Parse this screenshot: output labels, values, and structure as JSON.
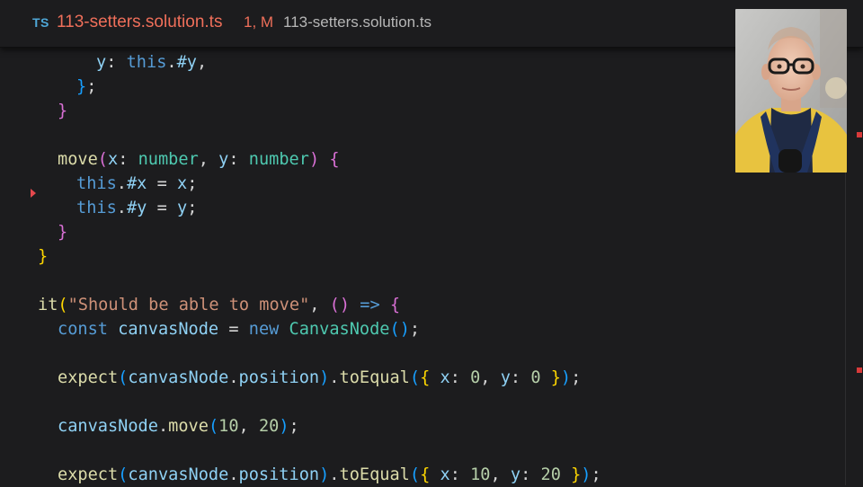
{
  "tab": {
    "lang_badge": "TS",
    "file_name": "113-setters.solution.ts",
    "status": "1, M",
    "breadcrumb": "113-setters.solution.ts"
  },
  "icons": {
    "fold": "fold-chevron-icon",
    "scroll_markers": "error-marker-icon"
  },
  "colors": {
    "background": "#1c1c1e",
    "modified_tab": "#ef6f5a",
    "ts_badge": "#4fa8d8",
    "error_marker": "#d83a3a"
  },
  "code": {
    "l1": {
      "a": "y",
      "b": ":",
      "c": "this",
      "d": ".",
      "e": "#y",
      "f": ","
    },
    "l2": {
      "a": "}",
      "b": ";"
    },
    "l3": {
      "a": "}"
    },
    "l4": {
      "a": "move",
      "b": "(",
      "c": "x",
      "d": ":",
      "e": "number",
      "f": ",",
      "g": "y",
      "h": ":",
      "i": "number",
      "j": ")",
      "k": "{"
    },
    "l5": {
      "a": "this",
      "b": ".",
      "c": "#x",
      "d": "=",
      "e": "x",
      "f": ";"
    },
    "l6": {
      "a": "this",
      "b": ".",
      "c": "#y",
      "d": "=",
      "e": "y",
      "f": ";"
    },
    "l7": {
      "a": "}"
    },
    "l8": {
      "a": "}"
    },
    "l9": {
      "a": "it",
      "b": "(",
      "c": "\"Should be able to move\"",
      "d": ",",
      "e": "()",
      "f": "=>",
      "g": "{"
    },
    "l10": {
      "a": "const",
      "b": "canvasNode",
      "c": "=",
      "d": "new",
      "e": "CanvasNode",
      "f": "()",
      "g": ";"
    },
    "l11": {
      "a": "expect",
      "b": "(",
      "c": "canvasNode",
      "d": ".",
      "e": "position",
      "f": ")",
      "g": ".",
      "h": "toEqual",
      "i": "(",
      "j": "{",
      "k": "x",
      "l": ":",
      "m": "0",
      "n": ",",
      "o": "y",
      "p": ":",
      "q": "0",
      "r": "}",
      "s": ")",
      "t": ";"
    },
    "l12": {
      "a": "canvasNode",
      "b": ".",
      "c": "move",
      "d": "(",
      "e": "10",
      "f": ",",
      "g": "20",
      "h": ")",
      "i": ";"
    },
    "l13": {
      "a": "expect",
      "b": "(",
      "c": "canvasNode",
      "d": ".",
      "e": "position",
      "f": ")",
      "g": ".",
      "h": "toEqual",
      "i": "(",
      "j": "{",
      "k": "x",
      "l": ":",
      "m": "10",
      "n": ",",
      "o": "y",
      "p": ":",
      "q": "20",
      "r": "}",
      "s": ")",
      "t": ";"
    }
  }
}
